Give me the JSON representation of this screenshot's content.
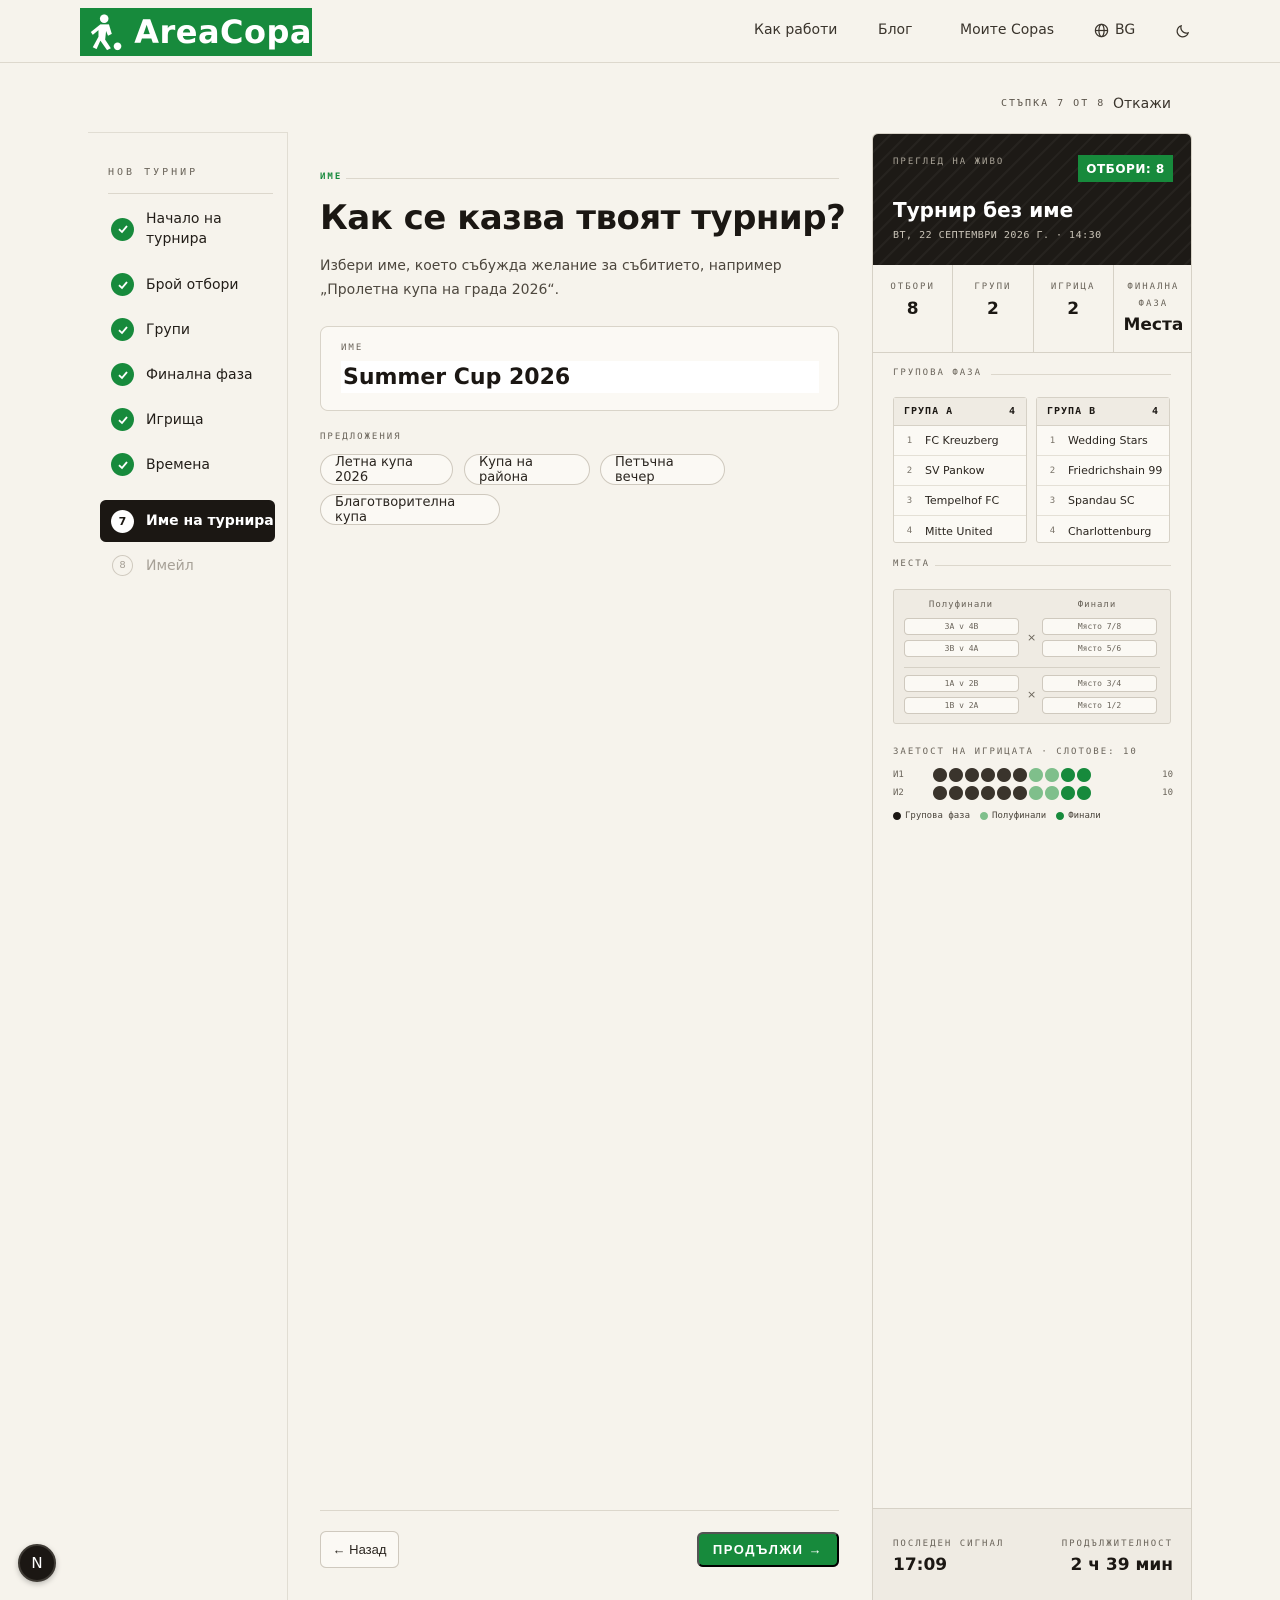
{
  "header": {
    "brand": "AreaCopa",
    "nav": {
      "how": "Как работи",
      "blog": "Блог",
      "mine": "Моите Copas",
      "lang": "BG"
    }
  },
  "progress": {
    "step_text": "СТЪПКА 7 ОТ 8",
    "cancel": "Откажи"
  },
  "sidebar": {
    "title": "НОВ ТУРНИР",
    "steps": [
      {
        "label": "Начало на турнира",
        "state": "done"
      },
      {
        "label": "Брой отбори",
        "state": "done"
      },
      {
        "label": "Групи",
        "state": "done"
      },
      {
        "label": "Финална фаза",
        "state": "done"
      },
      {
        "label": "Игрища",
        "state": "done"
      },
      {
        "label": "Времена",
        "state": "done"
      },
      {
        "number": "7",
        "label": "Име на турнира",
        "state": "active"
      },
      {
        "number": "8",
        "label": "Имейл",
        "state": "pending"
      }
    ]
  },
  "main": {
    "eyebrow": "ИМЕ",
    "title": "Как се казва твоят турнир?",
    "description": "Избери име, което събужда желание за събитието, например „Пролетна купа на града 2026“.",
    "field_label": "ИМЕ",
    "field_value": "Summer Cup 2026",
    "suggestions_title": "ПРЕДЛОЖЕНИЯ",
    "suggestions": [
      "Летна купа 2026",
      "Купа на района",
      "Петъчна вечер",
      "Благотворителна купа"
    ],
    "back": "← Назад",
    "next": "ПРОДЪЛЖИ →"
  },
  "preview": {
    "live_label": "ПРЕГЛЕД НА ЖИВО",
    "teams_badge": "ОТБОРИ: 8",
    "title": "Турнир без име",
    "date": "ВТ, 22 СЕПТЕМВРИ 2026 Г. · 14:30",
    "stats": [
      {
        "label": "ОТБОРИ",
        "value": "8"
      },
      {
        "label": "ГРУПИ",
        "value": "2"
      },
      {
        "label": "ИГРИЦА",
        "value": "2"
      },
      {
        "label": "ФИНАЛНА ФАЗА",
        "value": "Места"
      }
    ],
    "group_stage_label": "ГРУПОВА ФАЗА",
    "groups": [
      {
        "name": "ГРУПА А",
        "count": "4",
        "teams": [
          "FC Kreuzberg",
          "SV Pankow",
          "Tempelhof FC",
          "Mitte United"
        ]
      },
      {
        "name": "ГРУПА В",
        "count": "4",
        "teams": [
          "Wedding Stars",
          "Friedrichshain 99",
          "Spandau SC",
          "Charlottenburg"
        ]
      }
    ],
    "places_label": "МЕСТА",
    "places": {
      "semis_label": "Полуфинали",
      "finals_label": "Финали",
      "semis": [
        "3А v 4В",
        "3В v 4А",
        "1А v 2В",
        "1В v 2А"
      ],
      "finals": [
        "Място 7/8",
        "Място 5/6",
        "Място 3/4",
        "Място 1/2"
      ],
      "x": "×"
    },
    "usage_label": "ЗАЕТОСТ НА ИГРИЦАТА · СЛОТОВЕ: 10",
    "usage": [
      {
        "label": "И1",
        "count": "10",
        "slots": [
          "g",
          "g",
          "g",
          "g",
          "g",
          "g",
          "s",
          "s",
          "f",
          "f"
        ]
      },
      {
        "label": "И2",
        "count": "10",
        "slots": [
          "g",
          "g",
          "g",
          "g",
          "g",
          "g",
          "s",
          "s",
          "f",
          "f"
        ]
      }
    ],
    "legend": {
      "group": "Групова фаза",
      "semis": "Полуфинали",
      "finals": "Финали"
    },
    "colors": {
      "group": "#3a342c",
      "semis": "#7fbf8b",
      "finals": "#178a3c"
    },
    "footer": {
      "last_signal_label": "ПОСЛЕДЕН СИГНАЛ",
      "last_signal": "17:09",
      "duration_label": "ПРОДЪЛЖИТЕЛНОСТ",
      "duration": "2 ч 39 мин"
    }
  },
  "dev_badge": "N"
}
